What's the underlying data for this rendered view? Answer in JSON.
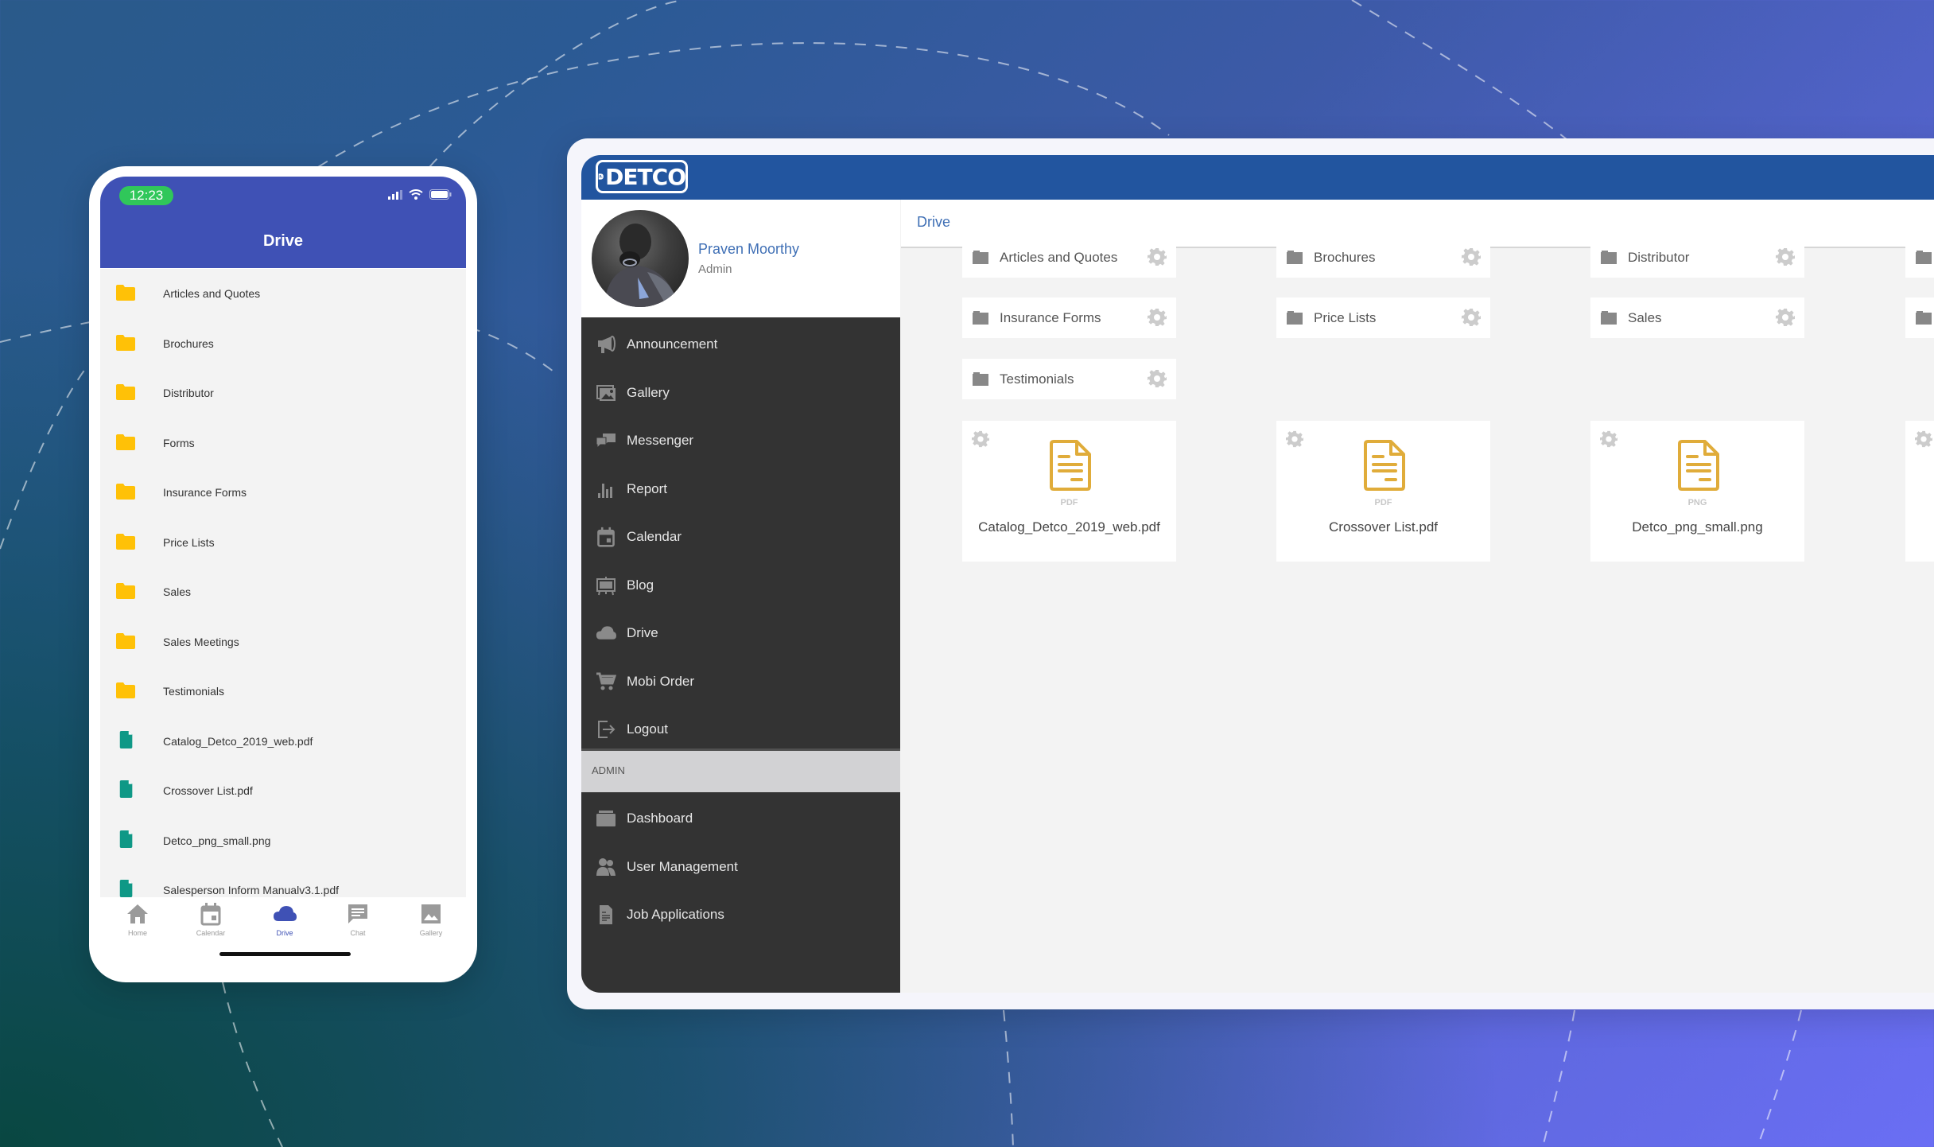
{
  "colors": {
    "phone_header": "#3f51b5",
    "web_header": "#22559f",
    "sidebar_bg": "#333333",
    "accent_link": "#3f6fb5",
    "folder_yellow": "#ffc107",
    "file_teal": "#0f9886",
    "doc_gold": "#e0ac3a"
  },
  "mobile": {
    "status_time": "12:23",
    "title": "Drive",
    "items": [
      {
        "label": "Articles and Quotes",
        "type": "folder",
        "icon": "folder-icon"
      },
      {
        "label": "Brochures",
        "type": "folder",
        "icon": "folder-icon"
      },
      {
        "label": "Distributor",
        "type": "folder",
        "icon": "folder-icon"
      },
      {
        "label": "Forms",
        "type": "folder",
        "icon": "folder-icon"
      },
      {
        "label": "Insurance Forms",
        "type": "folder",
        "icon": "folder-icon"
      },
      {
        "label": "Price Lists",
        "type": "folder",
        "icon": "folder-icon"
      },
      {
        "label": "Sales",
        "type": "folder",
        "icon": "folder-icon"
      },
      {
        "label": "Sales Meetings",
        "type": "folder",
        "icon": "folder-icon"
      },
      {
        "label": "Testimonials",
        "type": "folder",
        "icon": "folder-icon"
      },
      {
        "label": "Catalog_Detco_2019_web.pdf",
        "type": "file",
        "icon": "file-icon"
      },
      {
        "label": "Crossover List.pdf",
        "type": "file",
        "icon": "file-icon"
      },
      {
        "label": "Detco_png_small.png",
        "type": "file",
        "icon": "file-icon"
      },
      {
        "label": "Salesperson Inform Manualv3.1.pdf",
        "type": "file",
        "icon": "file-icon"
      }
    ],
    "nav": [
      {
        "label": "Home",
        "icon": "home-icon",
        "active": false
      },
      {
        "label": "Calendar",
        "icon": "calendar-icon",
        "active": false
      },
      {
        "label": "Drive",
        "icon": "cloud-icon",
        "active": true
      },
      {
        "label": "Chat",
        "icon": "chat-icon",
        "active": false
      },
      {
        "label": "Gallery",
        "icon": "image-icon",
        "active": false
      }
    ]
  },
  "web": {
    "logo_text": "DETCO",
    "profile": {
      "name": "Praven Moorthy",
      "role": "Admin"
    },
    "menu": [
      {
        "label": "Announcement",
        "icon": "megaphone-icon"
      },
      {
        "label": "Gallery",
        "icon": "gallery-icon"
      },
      {
        "label": "Messenger",
        "icon": "chat-bubbles-icon"
      },
      {
        "label": "Report",
        "icon": "bar-chart-icon"
      },
      {
        "label": "Calendar",
        "icon": "calendar-icon"
      },
      {
        "label": "Blog",
        "icon": "easel-icon"
      },
      {
        "label": "Drive",
        "icon": "cloud-icon"
      },
      {
        "label": "Mobi Order",
        "icon": "cart-icon"
      },
      {
        "label": "Logout",
        "icon": "logout-icon"
      }
    ],
    "admin_section_label": "ADMIN",
    "admin_menu": [
      {
        "label": "Dashboard",
        "icon": "drawer-icon"
      },
      {
        "label": "User Management",
        "icon": "users-icon"
      },
      {
        "label": "Job Applications",
        "icon": "document-icon"
      }
    ],
    "breadcrumb": "Drive",
    "folders": [
      "Articles and Quotes",
      "Brochures",
      "Distributor",
      "",
      "Insurance Forms",
      "Price Lists",
      "Sales",
      "",
      "Testimonials"
    ],
    "files": [
      {
        "name": "Catalog_Detco_2019_web.pdf",
        "type": "PDF"
      },
      {
        "name": "Crossover List.pdf",
        "type": "PDF"
      },
      {
        "name": "Detco_png_small.png",
        "type": "PNG"
      },
      {
        "name": "",
        "type": ""
      }
    ]
  }
}
